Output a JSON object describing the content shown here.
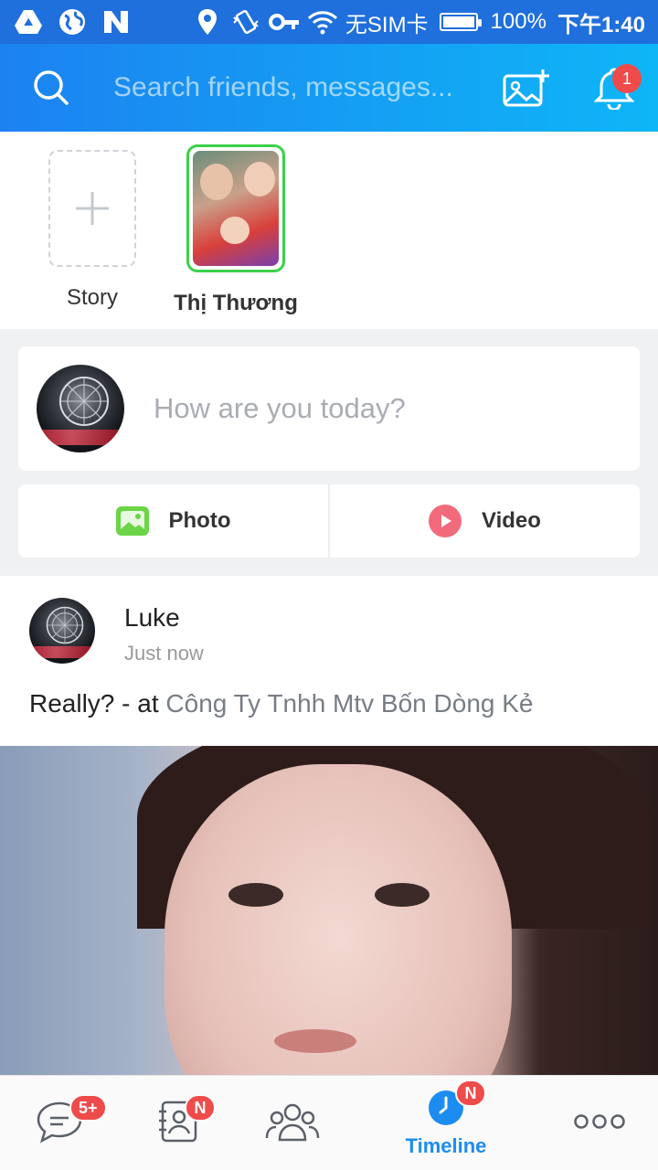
{
  "status_bar": {
    "carrier": "无SIM卡",
    "battery": "100%",
    "time": "下午1:40",
    "icons": [
      "drive-icon",
      "globe-icon",
      "n-logo-icon",
      "location-icon",
      "vibrate-icon",
      "vpn-key-icon",
      "wifi-icon",
      "battery-icon"
    ]
  },
  "header": {
    "search_placeholder": "Search friends, messages...",
    "notification_count": "1"
  },
  "stories": [
    {
      "label": "Story"
    },
    {
      "label": "Thị Thương"
    }
  ],
  "composer": {
    "prompt": "How are you today?",
    "photo_label": "Photo",
    "video_label": "Video"
  },
  "post": {
    "author": "Luke",
    "time": "Just now",
    "text": "Really? - at ",
    "location": "Công Ty Tnhh Mtv Bốn Dòng Kẻ"
  },
  "bottom_nav": {
    "messages_badge": "5+",
    "contacts_badge": "N",
    "timeline_badge": "N",
    "timeline_label": "Timeline"
  },
  "colors": {
    "header_start": "#1c82f1",
    "header_end": "#0eb6f6",
    "accent": "#1d8cf0",
    "badge": "#ef4b4b",
    "story_ring": "#3bd14a"
  }
}
